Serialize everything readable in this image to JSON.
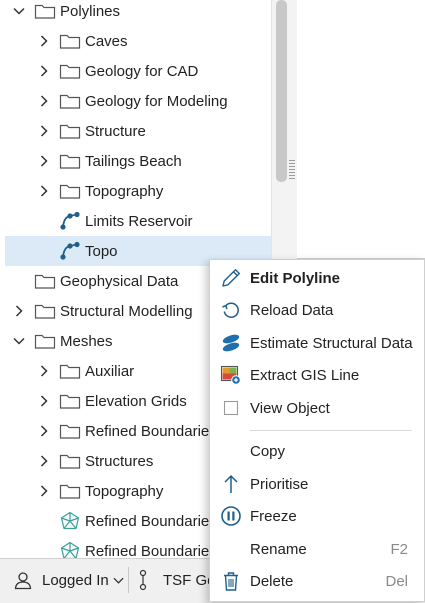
{
  "tree": {
    "rows": [
      {
        "label": "Polylines",
        "icon": "folder-icon",
        "expander": "expanded"
      },
      {
        "label": "Caves",
        "icon": "folder-icon",
        "expander": "collapsed"
      },
      {
        "label": "Geology for CAD",
        "icon": "folder-icon",
        "expander": "collapsed"
      },
      {
        "label": "Geology for Modeling",
        "icon": "folder-icon",
        "expander": "collapsed"
      },
      {
        "label": "Structure",
        "icon": "folder-icon",
        "expander": "collapsed"
      },
      {
        "label": "Tailings Beach",
        "icon": "folder-icon",
        "expander": "collapsed"
      },
      {
        "label": "Topography",
        "icon": "folder-icon",
        "expander": "collapsed"
      },
      {
        "label": "Limits Reservoir",
        "icon": "polyline-icon",
        "expander": "none"
      },
      {
        "label": "Topo",
        "icon": "polyline-icon",
        "expander": "none",
        "selected": true
      },
      {
        "label": "Geophysical Data",
        "icon": "folder-icon",
        "expander": "none"
      },
      {
        "label": "Structural Modelling",
        "icon": "folder-icon",
        "expander": "collapsed"
      },
      {
        "label": "Meshes",
        "icon": "folder-icon",
        "expander": "expanded"
      },
      {
        "label": "Auxiliar",
        "icon": "folder-icon",
        "expander": "collapsed"
      },
      {
        "label": "Elevation Grids",
        "icon": "folder-icon",
        "expander": "collapsed"
      },
      {
        "label": "Refined Boundaries",
        "icon": "folder-icon",
        "expander": "collapsed"
      },
      {
        "label": "Structures",
        "icon": "folder-icon",
        "expander": "collapsed"
      },
      {
        "label": "Topography",
        "icon": "folder-icon",
        "expander": "collapsed"
      },
      {
        "label": "Refined Boundaries",
        "icon": "mesh-icon",
        "expander": "none"
      },
      {
        "label": "Refined Boundaries",
        "icon": "mesh-icon",
        "expander": "none"
      }
    ]
  },
  "statusbar": {
    "user": "Logged In",
    "branch": "TSF Ge"
  },
  "context_menu": {
    "items": [
      {
        "label": "Edit Polyline",
        "icon": "pencil-icon",
        "bold": true,
        "shortcut": ""
      },
      {
        "label": "Reload Data",
        "icon": "reload-icon",
        "bold": false,
        "shortcut": ""
      },
      {
        "label": "Estimate Structural Data",
        "icon": "structural-data-icon",
        "bold": false,
        "shortcut": ""
      },
      {
        "label": "Extract GIS Line",
        "icon": "gis-line-icon",
        "bold": false,
        "shortcut": ""
      },
      {
        "label": "View Object",
        "icon": "checkbox-icon",
        "bold": false,
        "shortcut": ""
      },
      {
        "label": "Copy",
        "icon": "",
        "bold": false,
        "shortcut": ""
      },
      {
        "label": "Prioritise",
        "icon": "arrow-up-icon",
        "bold": false,
        "shortcut": ""
      },
      {
        "label": "Freeze",
        "icon": "pause-icon",
        "bold": false,
        "shortcut": ""
      },
      {
        "label": "Rename",
        "icon": "",
        "bold": false,
        "shortcut": "F2"
      },
      {
        "label": "Delete",
        "icon": "trash-icon",
        "bold": false,
        "shortcut": "Del"
      }
    ]
  },
  "colors": {
    "selection": "#dceaf8",
    "accent": "#1f5f8b",
    "tree_text": "#222222"
  }
}
